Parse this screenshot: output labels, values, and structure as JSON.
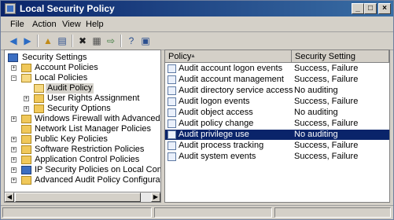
{
  "window": {
    "title": "Local Security Policy",
    "controls": {
      "minimize": "_",
      "maximize": "□",
      "close": "×"
    }
  },
  "menu": [
    "File",
    "Action",
    "View",
    "Help"
  ],
  "toolbar": {
    "icons": [
      "back-icon",
      "forward-icon",
      "up-icon",
      "show-hide-tree-icon",
      "delete-icon",
      "properties-icon",
      "export-list-icon",
      "help-icon",
      "help-topics-icon"
    ]
  },
  "tree": {
    "root": "Security Settings",
    "account_policies": "Account Policies",
    "local_policies": "Local Policies",
    "audit_policy": "Audit Policy",
    "user_rights": "User Rights Assignment",
    "security_options": "Security Options",
    "windows_firewall": "Windows Firewall with Advanced Security",
    "network_list": "Network List Manager Policies",
    "public_key": "Public Key Policies",
    "software_restriction": "Software Restriction Policies",
    "app_control": "Application Control Policies",
    "ipsec": "IP Security Policies on Local Computer",
    "advanced_audit": "Advanced Audit Policy Configuration"
  },
  "list": {
    "col_policy": "Policy",
    "col_setting": "Security Setting",
    "sort_indicator": "▲",
    "rows": [
      {
        "policy": "Audit account logon events",
        "setting": "Success, Failure"
      },
      {
        "policy": "Audit account management",
        "setting": "Success, Failure"
      },
      {
        "policy": "Audit directory service access",
        "setting": "No auditing"
      },
      {
        "policy": "Audit logon events",
        "setting": "Success, Failure"
      },
      {
        "policy": "Audit object access",
        "setting": "No auditing"
      },
      {
        "policy": "Audit policy change",
        "setting": "Success, Failure"
      },
      {
        "policy": "Audit privilege use",
        "setting": "No auditing",
        "selected": true
      },
      {
        "policy": "Audit process tracking",
        "setting": "Success, Failure"
      },
      {
        "policy": "Audit system events",
        "setting": "Success, Failure"
      }
    ]
  },
  "colors": {
    "title_bar": "#0a246a",
    "selection": "#0a246a",
    "folder": "#f0c85a"
  }
}
